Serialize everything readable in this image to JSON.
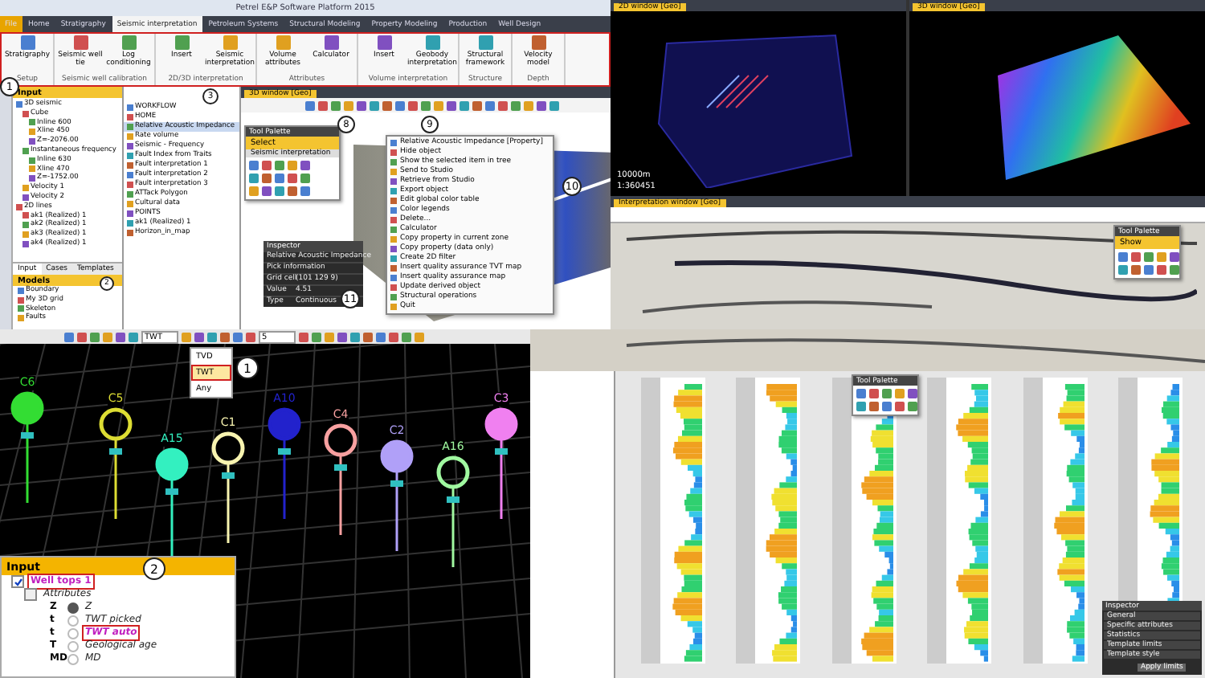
{
  "main_window": {
    "title": "Petrel E&P Software Platform 2015",
    "ribbon_tabs": [
      {
        "label": "File",
        "selected": false
      },
      {
        "label": "Home",
        "selected": false
      },
      {
        "label": "Stratigraphy",
        "selected": false
      },
      {
        "label": "Seismic interpretation",
        "selected": true
      },
      {
        "label": "Petroleum Systems",
        "selected": false
      },
      {
        "label": "Structural Modeling",
        "selected": false
      },
      {
        "label": "Property Modeling",
        "selected": false
      },
      {
        "label": "Production",
        "selected": false
      },
      {
        "label": "Well Design",
        "selected": false
      }
    ],
    "ribbon_groups": [
      {
        "label": "Setup",
        "buttons": [
          "Stratigraphy"
        ]
      },
      {
        "label": "Seismic well calibration",
        "buttons": [
          "Seismic well tie",
          "Log conditioning"
        ]
      },
      {
        "label": "2D/3D interpretation",
        "buttons": [
          "Insert",
          "Seismic interpretation"
        ]
      },
      {
        "label": "Attributes",
        "buttons": [
          "Volume attributes",
          "Calculator"
        ]
      },
      {
        "label": "Volume interpretation",
        "buttons": [
          "Insert",
          "Geobody interpretation"
        ]
      },
      {
        "label": "Structure",
        "buttons": [
          "Structural framework"
        ]
      },
      {
        "label": "Depth",
        "buttons": [
          "Velocity model"
        ]
      }
    ],
    "input_title": "Input",
    "input_tree": [
      {
        "label": "3D seismic",
        "children": [
          {
            "label": "Cube",
            "children": [
              {
                "label": "Inline 600"
              },
              {
                "label": "Xline 450"
              },
              {
                "label": "Z=-2076.00"
              }
            ]
          },
          {
            "label": "Instantaneous frequency",
            "children": [
              {
                "label": "Inline 630"
              },
              {
                "label": "Xline 470"
              },
              {
                "label": "Z=-1752.00"
              }
            ]
          },
          {
            "label": "Velocity 1"
          },
          {
            "label": "Velocity 2"
          }
        ]
      },
      {
        "label": "2D lines",
        "children": [
          {
            "label": "ak1 (Realized) 1"
          },
          {
            "label": "ak2 (Realized) 1"
          },
          {
            "label": "ak3 (Realized) 1"
          },
          {
            "label": "ak4 (Realized) 1"
          }
        ]
      }
    ],
    "panel_tabs": [
      {
        "label": "Input",
        "selected": true
      },
      {
        "label": "Cases",
        "selected": false
      },
      {
        "label": "Templates",
        "selected": false
      }
    ],
    "models_panel": {
      "title": "Models",
      "items": [
        "Boundary",
        "My 3D grid",
        "Skeleton",
        "Faults"
      ]
    },
    "objects_list": [
      {
        "label": "WORKFLOW",
        "selected": false
      },
      {
        "label": "HOME",
        "selected": false
      },
      {
        "label": "Relative Acoustic Impedance",
        "selected": true
      },
      {
        "label": "Rate volume",
        "selected": false
      },
      {
        "label": "Seismic - Frequency",
        "selected": false
      },
      {
        "label": "Fault Index from Traits",
        "selected": false
      },
      {
        "label": "Fault interpretation 1",
        "selected": false
      },
      {
        "label": "Fault interpretation 2",
        "selected": false
      },
      {
        "label": "Fault interpretation 3",
        "selected": false
      },
      {
        "label": "ATTack Polygon",
        "selected": false
      },
      {
        "label": "Cultural data",
        "selected": false
      },
      {
        "label": "POINTS",
        "selected": false
      },
      {
        "label": "ak1 (Realized) 1",
        "selected": false
      },
      {
        "label": "Horizon_in_map",
        "selected": false
      }
    ],
    "viewport_tab": "3D window [Geo]",
    "tool_palette": {
      "title": "Tool Palette",
      "select": "Select",
      "section": "Seismic interpretation"
    },
    "context_menu": [
      "Relative Acoustic Impedance [Property]",
      "Hide object",
      "Show the selected item in tree",
      "Send to Studio",
      "Retrieve from Studio",
      "Export object",
      "Edit global color table",
      "Color legends",
      "Delete...",
      "Calculator",
      "Copy property in current zone",
      "Copy property (data only)",
      "Create 2D filter",
      "Insert quality assurance TVT map",
      "Insert quality assurance map",
      "Update derived object",
      "Structural operations",
      "Quit"
    ],
    "inspector": {
      "title": "Inspector",
      "object": "Relative Acoustic Impedance",
      "section": "Pick information",
      "rows": [
        {
          "key": "Grid cell",
          "value": "(101 129 9)"
        },
        {
          "key": "Value",
          "value": "4.51"
        },
        {
          "key": "Type",
          "value": "Continuous"
        }
      ]
    },
    "callouts": [
      "1",
      "3",
      "8",
      "9",
      "10",
      "11",
      "2"
    ]
  },
  "map_window": {
    "tab": "2D window [Geo]",
    "scale": "10000m",
    "ratio": "1:360451"
  },
  "surface_window": {
    "tab": "3D window [Geo]"
  },
  "section_window": {
    "tab": "Interpretation window [Geo]",
    "palette_title": "Tool Palette",
    "palette_select": "Show"
  },
  "wells_view": {
    "domain": {
      "value": "TWT",
      "options": [
        {
          "label": "TVD",
          "selected": false
        },
        {
          "label": "TWT",
          "selected": true
        },
        {
          "label": "Any",
          "selected": false
        }
      ]
    },
    "zoom_value": "5",
    "wells": [
      {
        "label": "C6",
        "color": "#33dd33"
      },
      {
        "label": "C5",
        "color": "#dddd33"
      },
      {
        "label": "A15",
        "color": "#33f0c0"
      },
      {
        "label": "C1",
        "color": "#f8f4b0"
      },
      {
        "label": "A10",
        "color": "#2222cc"
      },
      {
        "label": "C4",
        "color": "#f8a0a0"
      },
      {
        "label": "C2",
        "color": "#b0a0f8"
      },
      {
        "label": "A16",
        "color": "#a0f8a0"
      },
      {
        "label": "C3",
        "color": "#f080f0"
      }
    ],
    "callouts": [
      "1",
      "2"
    ],
    "input_panel": {
      "title": "Input",
      "items": [
        {
          "kind": "folder",
          "label": "Well tops 1",
          "checked": true,
          "highlighted": true
        },
        {
          "kind": "folder",
          "label": "Attributes",
          "checked": false,
          "highlighted": false
        },
        {
          "kind": "attr",
          "symbol": "Z",
          "label": "Z",
          "selected": true,
          "highlighted": false
        },
        {
          "kind": "attr",
          "symbol": "t",
          "label": "TWT picked",
          "selected": false,
          "highlighted": false
        },
        {
          "kind": "attr",
          "symbol": "t",
          "label": "TWT auto",
          "selected": false,
          "highlighted": true
        },
        {
          "kind": "attr",
          "symbol": "T",
          "label": "Geological age",
          "selected": false,
          "highlighted": false
        },
        {
          "kind": "attr",
          "symbol": "MD",
          "label": "MD",
          "selected": false,
          "highlighted": false
        }
      ]
    }
  },
  "logs_view": {
    "palette_title": "Tool Palette",
    "inspector_title": "Inspector",
    "inspector_sections": [
      "General",
      "Specific attributes",
      "Statistics",
      "Template limits",
      "Template style"
    ],
    "apply": "Apply limits"
  }
}
